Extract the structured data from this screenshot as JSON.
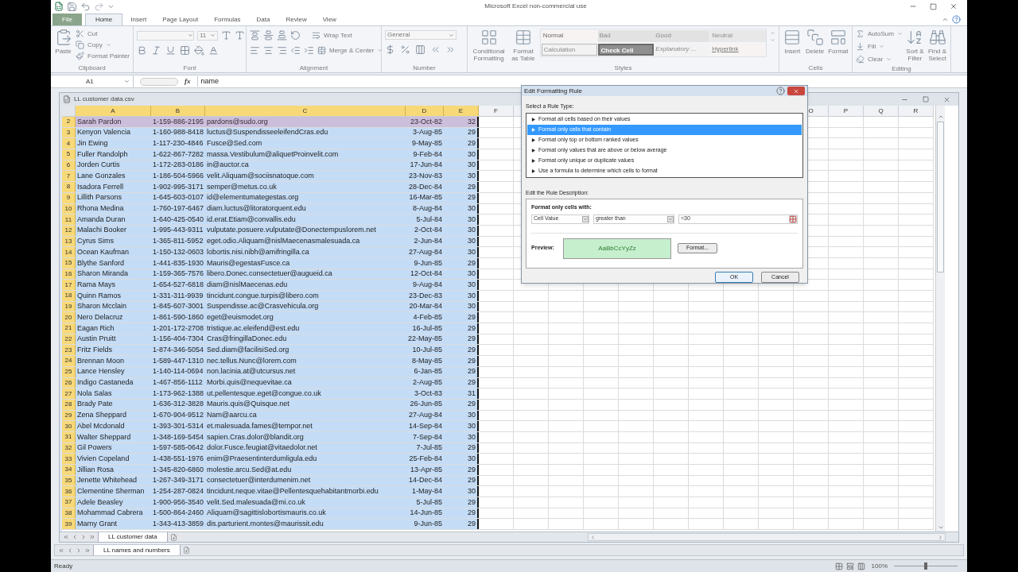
{
  "window": {
    "title": "Microsoft Excel non-commercial use"
  },
  "ribbon_tabs": [
    {
      "label": "File",
      "kind": "file",
      "selected": false
    },
    {
      "label": "Home",
      "kind": "tab",
      "selected": true
    },
    {
      "label": "Insert",
      "kind": "tab",
      "selected": false
    },
    {
      "label": "Page Layout",
      "kind": "tab",
      "selected": false
    },
    {
      "label": "Formulas",
      "kind": "tab",
      "selected": false
    },
    {
      "label": "Data",
      "kind": "tab",
      "selected": false
    },
    {
      "label": "Review",
      "kind": "tab",
      "selected": false
    },
    {
      "label": "View",
      "kind": "tab",
      "selected": false
    }
  ],
  "clipboard": {
    "label": "Clipboard",
    "paste": "Paste",
    "cut": "Cut",
    "copy": "Copy",
    "format_painter": "Format Painter"
  },
  "font": {
    "label": "Font",
    "size": "11"
  },
  "alignment": {
    "label": "Alignment",
    "wrap_text": "Wrap Text",
    "merge_center": "Merge & Center"
  },
  "number": {
    "label": "Number",
    "format": "General"
  },
  "styles": {
    "label": "Styles",
    "conditional_formatting": "Conditional Formatting",
    "format_as_table": "Format as Table",
    "gallery": [
      {
        "label": "Normal",
        "kind": "normal"
      },
      {
        "label": "Bad",
        "kind": "bad"
      },
      {
        "label": "Good",
        "kind": "good"
      },
      {
        "label": "Neutral",
        "kind": "neutral"
      },
      {
        "label": "Calculation",
        "kind": "calculation"
      },
      {
        "label": "Check Cell",
        "kind": "check"
      },
      {
        "label": "Explanatory ...",
        "kind": "explanatory"
      },
      {
        "label": "Hyperlink",
        "kind": "hyperlink"
      }
    ]
  },
  "cells": {
    "label": "Cells",
    "insert": "Insert",
    "delete": "Delete",
    "format": "Format"
  },
  "editing": {
    "label": "Editing",
    "autosum": "AutoSum",
    "fill": "Fill",
    "clear": "Clear",
    "sort_filter": "Sort & Filter",
    "find_select": "Find & Select"
  },
  "formula_bar": {
    "name_box": "A1",
    "fx": "fx",
    "content": "name"
  },
  "workbook": {
    "title": "LL customer data.csv",
    "columns": [
      {
        "label": "A",
        "selected": true
      },
      {
        "label": "B",
        "selected": true
      },
      {
        "label": "C",
        "selected": true
      },
      {
        "label": "D",
        "selected": true
      },
      {
        "label": "E",
        "selected": true
      },
      {
        "label": "F",
        "selected": false
      }
    ],
    "right_columns": [
      "O",
      "P",
      "Q",
      "R"
    ],
    "rows": [
      {
        "number": "2",
        "selected": true,
        "highlighted": true,
        "cells": [
          "Sarah Pardon",
          "1-159-886-2195",
          "pardons@sudo.org",
          "23-Oct-82",
          "32"
        ]
      },
      {
        "number": "3",
        "selected": true,
        "highlighted": false,
        "cells": [
          "Kenyon Valencia",
          "1-160-988-8418",
          "luctus@SuspendisseeleifendCras.edu",
          "3-Aug-85",
          "29"
        ]
      },
      {
        "number": "4",
        "selected": true,
        "highlighted": false,
        "cells": [
          "Jin Ewing",
          "1-117-230-4846",
          "Fusce@Sed.com",
          "9-May-85",
          "29"
        ]
      },
      {
        "number": "5",
        "selected": true,
        "highlighted": false,
        "cells": [
          "Fuller Randolph",
          "1-622-867-7282",
          "massa.Vestibulum@aliquetProinvelit.com",
          "9-Feb-84",
          "30"
        ]
      },
      {
        "number": "6",
        "selected": true,
        "highlighted": false,
        "cells": [
          "Jorden Curtis",
          "1-172-283-0186",
          "in@auctor.ca",
          "17-Jun-84",
          "30"
        ]
      },
      {
        "number": "7",
        "selected": true,
        "highlighted": false,
        "cells": [
          "Lane Gonzales",
          "1-186-504-5966",
          "velit.Aliquam@sociisnatoque.com",
          "23-Nov-83",
          "30"
        ]
      },
      {
        "number": "8",
        "selected": true,
        "highlighted": false,
        "cells": [
          "Isadora Ferrell",
          "1-902-995-3171",
          "semper@metus.co.uk",
          "28-Dec-84",
          "29"
        ]
      },
      {
        "number": "9",
        "selected": true,
        "highlighted": false,
        "cells": [
          "Lillith Parsons",
          "1-645-603-0107",
          "id@elementumategestas.org",
          "16-Mar-85",
          "29"
        ]
      },
      {
        "number": "10",
        "selected": true,
        "highlighted": false,
        "cells": [
          "Rhona Medina",
          "1-760-197-6467",
          "diam.luctus@litoratorquent.edu",
          "8-Aug-84",
          "30"
        ]
      },
      {
        "number": "11",
        "selected": true,
        "highlighted": false,
        "cells": [
          "Amanda Duran",
          "1-640-425-0540",
          "id.erat.Etiam@convallis.edu",
          "5-Jul-84",
          "30"
        ]
      },
      {
        "number": "12",
        "selected": true,
        "highlighted": false,
        "cells": [
          "Malachi Booker",
          "1-995-443-9311",
          "vulputate.posuere.vulputate@Donectempuslorem.net",
          "2-Oct-84",
          "30"
        ]
      },
      {
        "number": "13",
        "selected": true,
        "highlighted": false,
        "cells": [
          "Cyrus Sims",
          "1-365-811-5952",
          "eget.odio.Aliquam@nislMaecenasmalesuada.ca",
          "2-Jun-84",
          "30"
        ]
      },
      {
        "number": "14",
        "selected": true,
        "highlighted": false,
        "cells": [
          "Ocean Kaufman",
          "1-150-132-0603",
          "lobortis.nisi.nibh@amifringilla.ca",
          "27-Aug-84",
          "30"
        ]
      },
      {
        "number": "15",
        "selected": true,
        "highlighted": false,
        "cells": [
          "Blythe Sanford",
          "1-441-835-1930",
          "Mauris@egestasFusce.ca",
          "9-Jun-85",
          "29"
        ]
      },
      {
        "number": "16",
        "selected": true,
        "highlighted": false,
        "cells": [
          "Sharon Miranda",
          "1-159-365-7576",
          "libero.Donec.consectetuer@augueid.ca",
          "12-Oct-84",
          "30"
        ]
      },
      {
        "number": "17",
        "selected": true,
        "highlighted": false,
        "cells": [
          "Rama Mays",
          "1-654-527-6818",
          "diam@nislMaecenas.edu",
          "9-Aug-84",
          "30"
        ]
      },
      {
        "number": "18",
        "selected": true,
        "highlighted": false,
        "cells": [
          "Quinn Ramos",
          "1-331-311-9939",
          "tincidunt.congue.turpis@libero.com",
          "23-Dec-83",
          "30"
        ]
      },
      {
        "number": "19",
        "selected": true,
        "highlighted": false,
        "cells": [
          "Sharon Mcclain",
          "1-845-607-3001",
          "Suspendisse.ac@Crasvehicula.org",
          "20-Mar-84",
          "30"
        ]
      },
      {
        "number": "20",
        "selected": true,
        "highlighted": false,
        "cells": [
          "Nero Delacruz",
          "1-861-590-1860",
          "eget@euismodet.org",
          "4-Feb-85",
          "29"
        ]
      },
      {
        "number": "21",
        "selected": true,
        "highlighted": false,
        "cells": [
          "Eagan Rich",
          "1-201-172-2708",
          "tristique.ac.eleifend@est.edu",
          "16-Jul-85",
          "29"
        ]
      },
      {
        "number": "22",
        "selected": true,
        "highlighted": false,
        "cells": [
          "Austin Pruitt",
          "1-156-404-7304",
          "Cras@fringillaDonec.edu",
          "22-May-85",
          "29"
        ]
      },
      {
        "number": "23",
        "selected": true,
        "highlighted": false,
        "cells": [
          "Fritz Fields",
          "1-874-346-5054",
          "Sed.diam@facilisiSed.org",
          "10-Jul-85",
          "29"
        ]
      },
      {
        "number": "24",
        "selected": true,
        "highlighted": false,
        "cells": [
          "Brennan Moon",
          "1-589-447-1310",
          "nec.tellus.Nunc@lorem.com",
          "8-May-85",
          "29"
        ]
      },
      {
        "number": "25",
        "selected": true,
        "highlighted": false,
        "cells": [
          "Lance Hensley",
          "1-140-114-0694",
          "non.lacinia.at@utcursus.net",
          "6-Jan-85",
          "29"
        ]
      },
      {
        "number": "26",
        "selected": true,
        "highlighted": false,
        "cells": [
          "Indigo Castaneda",
          "1-467-856-1112",
          "Morbi.quis@nequevitae.ca",
          "2-Aug-85",
          "29"
        ]
      },
      {
        "number": "27",
        "selected": true,
        "highlighted": false,
        "cells": [
          "Nola Salas",
          "1-173-962-1388",
          "ut.pellentesque.eget@congue.co.uk",
          "3-Oct-83",
          "31"
        ]
      },
      {
        "number": "28",
        "selected": true,
        "highlighted": false,
        "cells": [
          "Brady Pate",
          "1-636-312-3828",
          "Mauris.quis@Quisque.net",
          "26-Jun-85",
          "29"
        ]
      },
      {
        "number": "29",
        "selected": true,
        "highlighted": false,
        "cells": [
          "Zena Sheppard",
          "1-670-904-9512",
          "Nam@aarcu.ca",
          "27-Aug-84",
          "30"
        ]
      },
      {
        "number": "30",
        "selected": true,
        "highlighted": false,
        "cells": [
          "Abel Mcdonald",
          "1-393-301-5314",
          "et.malesuada.fames@tempor.net",
          "14-Sep-84",
          "30"
        ]
      },
      {
        "number": "31",
        "selected": true,
        "highlighted": false,
        "cells": [
          "Walter Sheppard",
          "1-348-169-5454",
          "sapien.Cras.dolor@blandit.org",
          "7-Sep-84",
          "30"
        ]
      },
      {
        "number": "32",
        "selected": true,
        "highlighted": false,
        "cells": [
          "Gil Powers",
          "1-597-585-0642",
          "dolor.Fusce.feugiat@vitaedolor.net",
          "7-Jul-85",
          "29"
        ]
      },
      {
        "number": "33",
        "selected": true,
        "highlighted": false,
        "cells": [
          "Vivien Copeland",
          "1-438-551-1976",
          "enim@Praesentinterdumligula.edu",
          "25-Feb-84",
          "30"
        ]
      },
      {
        "number": "34",
        "selected": true,
        "highlighted": false,
        "cells": [
          "Jillian Rosa",
          "1-345-820-6860",
          "molestie.arcu.Sed@at.edu",
          "13-Apr-85",
          "29"
        ]
      },
      {
        "number": "35",
        "selected": true,
        "highlighted": false,
        "cells": [
          "Jenette Whitehead",
          "1-267-349-3171",
          "consectetuer@interdumenim.net",
          "14-Dec-84",
          "29"
        ]
      },
      {
        "number": "36",
        "selected": true,
        "highlighted": false,
        "cells": [
          "Clementine Sherman",
          "1-254-287-0824",
          "tincidunt.neque.vitae@Pellentesquehabitantmorbi.edu",
          "1-May-84",
          "30"
        ]
      },
      {
        "number": "37",
        "selected": true,
        "highlighted": false,
        "cells": [
          "Adele Beasley",
          "1-900-956-3540",
          "velit.Sed.malesuada@mi.co.uk",
          "5-Jul-85",
          "29"
        ]
      },
      {
        "number": "38",
        "selected": true,
        "highlighted": false,
        "cells": [
          "Mohammad Cabrera",
          "1-500-864-2460",
          "Aliquam@sagittislobortismauris.co.uk",
          "14-Jun-85",
          "29"
        ]
      },
      {
        "number": "39",
        "selected": true,
        "highlighted": false,
        "cells": [
          "Marny Grant",
          "1-343-413-3859",
          "dis.parturient.montes@maurissit.edu",
          "9-Jun-85",
          "29"
        ]
      }
    ],
    "sheet_tab": {
      "label": "LL customer data",
      "selected": true
    }
  },
  "outer_sheet_tab": {
    "label": "LL names and numbers",
    "selected": true
  },
  "status_bar": {
    "text": "Ready",
    "zoom": "100%",
    "zoom_slider": {
      "level": 0.5
    }
  },
  "dialog": {
    "title": "Edit Formatting Rule",
    "rule_type_label": "Select a Rule Type:",
    "rule_types": [
      {
        "label": "Format all cells based on their values",
        "selected": false
      },
      {
        "label": "Format only cells that contain",
        "selected": true
      },
      {
        "label": "Format only top or bottom ranked values",
        "selected": false
      },
      {
        "label": "Format only values that are above or below average",
        "selected": false
      },
      {
        "label": "Format only unique or duplicate values",
        "selected": false
      },
      {
        "label": "Use a formula to determine which cells to format",
        "selected": false
      }
    ],
    "description_label": "Edit the Rule Description:",
    "condition_heading": "Format only cells with:",
    "condition_field": "Cell Value",
    "operator": "greater than",
    "value": "=30",
    "preview_label": "Preview:",
    "preview_sample": "AaBbCcYyZz",
    "format_button": "Format...",
    "ok": "OK",
    "cancel": "Cancel"
  }
}
